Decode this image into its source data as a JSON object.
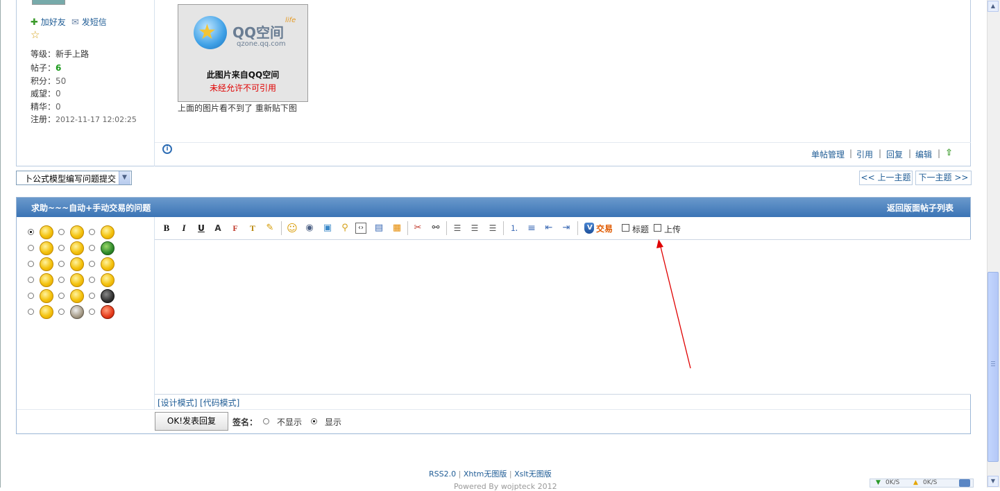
{
  "user": {
    "add_friend": "加好友",
    "send_message": "发短信",
    "stats": [
      {
        "key": "等级：",
        "value": "新手上路",
        "style": "plain"
      },
      {
        "key": "帖子：",
        "value": "6",
        "style": "green"
      },
      {
        "key": "积分：",
        "value": "50",
        "style": "muted"
      },
      {
        "key": "威望：",
        "value": "0",
        "style": "muted"
      },
      {
        "key": "精华：",
        "value": "0",
        "style": "muted"
      },
      {
        "key": "注册：",
        "value": "2012-11-17 12:02:25",
        "style": "muted"
      }
    ]
  },
  "post": {
    "image_logo_text": "QQ空间",
    "image_logo_sub": "life",
    "image_domain": "qzone.qq.com",
    "image_notice_line1": "此图片来自QQ空间",
    "image_notice_line2": "未经允许不可引用",
    "body_text": "上面的图片看不到了  重新贴下图",
    "actions": [
      "单帖管理",
      "引用",
      "回复",
      "编辑"
    ]
  },
  "forum_select": {
    "selected": "卜公式模型编写问题提交"
  },
  "nav": {
    "prev": "<< 上一主题",
    "next": "下一主题 >>"
  },
  "reply": {
    "title": "求助~~~自动+手动交易的问题",
    "back_link": "返回版面帖子列表",
    "toolbar": {
      "trade_label": "交易",
      "title_label": "标题",
      "upload_label": "上传"
    },
    "modes": [
      "[设计模式]",
      "[代码模式]"
    ],
    "submit": "OK!发表回复",
    "signature_label": "签名：",
    "signature_options": [
      "不显示",
      "显示"
    ],
    "signature_selected": "显示"
  },
  "footer": {
    "links": [
      "RSS2.0",
      "Xhtm无图版",
      "Xslt无图版"
    ],
    "powered": "Powered By wojpteck 2012"
  },
  "tray": {
    "down": "0K/S",
    "up": "0K/S"
  },
  "colors": {
    "header_blue": "#3b74b5",
    "link_blue": "#1f5c95",
    "green": "#1a9a1a",
    "notice_red": "#e00000",
    "arrow_red": "#e00000"
  }
}
